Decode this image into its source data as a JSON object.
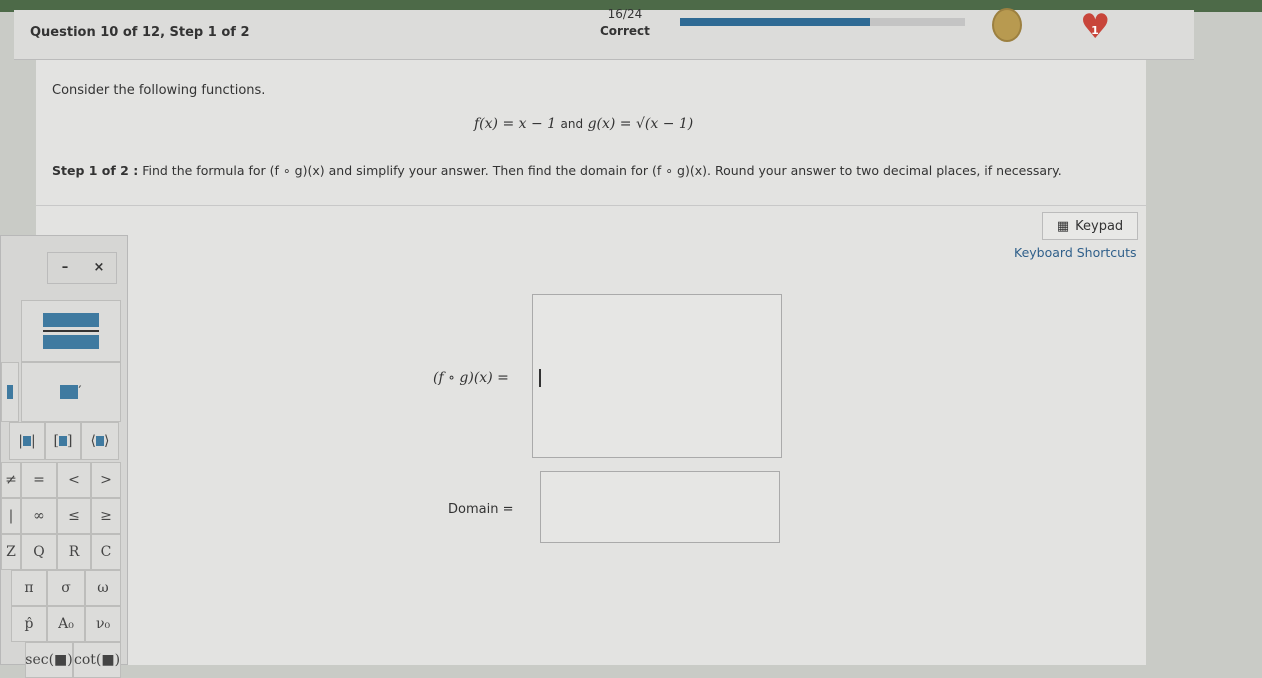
{
  "header": {
    "question": "Question 10 of 12, Step 1 of 2",
    "score": "16/24",
    "score_label": "Correct",
    "progress_fraction": 0.667,
    "coin_icon": "coin-icon",
    "hearts": "1"
  },
  "content": {
    "intro": "Consider the following functions.",
    "f_def": "f(x) = x − 1",
    "and": "and",
    "g_def": "g(x) = √(x − 1)",
    "step_label": "Step 1 of 2 :",
    "step_text": "Find the formula for (f ∘ g)(x) and simplify your answer. Then find the domain for (f ∘ g)(x). Round your answer to two decimal places, if necessary."
  },
  "tools": {
    "keypad": "Keypad",
    "shortcuts": "Keyboard Shortcuts"
  },
  "answer": {
    "fog_label": "(f ∘ g)(x) =",
    "fog_value": "",
    "domain_label": "Domain =",
    "domain_value": ""
  },
  "keypad": {
    "minimize": "–",
    "close": "×",
    "row_rel": [
      "≠",
      "=",
      "<",
      ">"
    ],
    "row_rel2": [
      "|",
      "∞",
      "≤",
      "≥"
    ],
    "row_sets": [
      "Z",
      "Q",
      "R",
      "C"
    ],
    "row_greek": [
      "π",
      "σ",
      "ω"
    ],
    "row_units": [
      "p̂",
      "A₀",
      "ν₀"
    ],
    "row_trig": [
      "sec(■)",
      "cot(■)"
    ]
  }
}
